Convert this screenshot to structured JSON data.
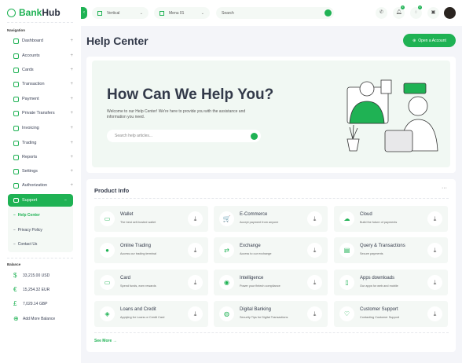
{
  "brand": {
    "name_a": "Bank",
    "name_b": "Hub"
  },
  "sidebar": {
    "nav_label": "Navigation",
    "items": [
      {
        "label": "Dashboard"
      },
      {
        "label": "Accounts"
      },
      {
        "label": "Cards"
      },
      {
        "label": "Transaction"
      },
      {
        "label": "Payment"
      },
      {
        "label": "Private Transfers"
      },
      {
        "label": "Invoicing"
      },
      {
        "label": "Trading"
      },
      {
        "label": "Reports"
      },
      {
        "label": "Settings"
      },
      {
        "label": "Authorization"
      }
    ],
    "active": "Support",
    "sub_items": [
      {
        "label": "Help Center"
      },
      {
        "label": "Privacy Policy"
      },
      {
        "label": "Contact Us"
      }
    ],
    "balance_label": "Balance",
    "balances": [
      {
        "icon": "$",
        "label": "33,215.00 USD"
      },
      {
        "icon": "€",
        "label": "15,254.32 EUR"
      },
      {
        "icon": "£",
        "label": "7,029.14 GBP"
      },
      {
        "icon": "⊕",
        "label": "Add More Balance"
      }
    ]
  },
  "topbar": {
    "layout": "Vertical",
    "menu": "Menu 01",
    "search_placeholder": "Search",
    "notif_count": "0",
    "msg_count": "0"
  },
  "page": {
    "title": "Help Center",
    "open_account": "Open a Account"
  },
  "hero": {
    "title": "How Can We Help You?",
    "text": "Welcome to our Help Center! We're here to provide you with the assistance and information you need.",
    "search_placeholder": "Search help articles..."
  },
  "product": {
    "title": "Product Info",
    "see_more": "See More →",
    "tiles": [
      {
        "title": "Wallet",
        "sub": "The best self-hosted wallet",
        "icon": "▭"
      },
      {
        "title": "E-Commerce",
        "sub": "Accept payment from anyone",
        "icon": "🛒"
      },
      {
        "title": "Cloud",
        "sub": "Build the future of payments",
        "icon": "☁"
      },
      {
        "title": "Online Trading",
        "sub": "Access our trading terminal",
        "icon": "●"
      },
      {
        "title": "Exchange",
        "sub": "Access to our exchange",
        "icon": "⇄"
      },
      {
        "title": "Query & Transactions",
        "sub": "Secure payments",
        "icon": "▤"
      },
      {
        "title": "Card",
        "sub": "Spend funds, earn rewards",
        "icon": "▭"
      },
      {
        "title": "Intelligence",
        "sub": "Power your fintech compliance",
        "icon": "◉"
      },
      {
        "title": "Apps downloads",
        "sub": "Our apps for web and mobile",
        "icon": "▯"
      },
      {
        "title": "Loans and Credit",
        "sub": "Applying for Loans or Credit Card",
        "icon": "◈"
      },
      {
        "title": "Digital Banking",
        "sub": "Security Tips for Digital Transactions",
        "icon": "◍"
      },
      {
        "title": "Customer Support",
        "sub": "Contacting Customer Support",
        "icon": "♡"
      }
    ]
  }
}
